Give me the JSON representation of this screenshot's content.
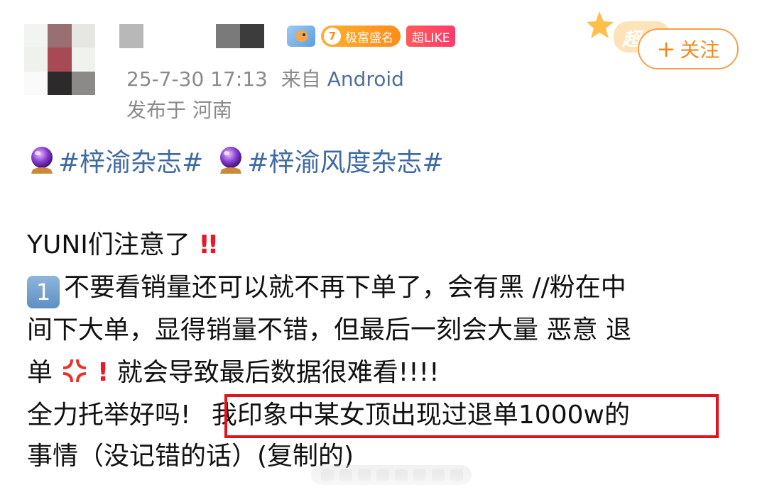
{
  "header": {
    "level": "7",
    "level_title": "极富盛名",
    "like_badge": "超LIKE",
    "timestamp": "25-7-30 17:13",
    "source_prefix": "来自",
    "source": "Android",
    "location": "发布于 河南",
    "super_deco_text": "超",
    "follow_plus": "+",
    "follow_label": "关注"
  },
  "hashtags": [
    "#梓渝杂志#",
    "#梓渝风度杂志#"
  ],
  "post": {
    "line1": "YUNI们注意了",
    "line1_mark": "!!",
    "item1_number": "1",
    "line2": "不要看销量还可以就不再下单了，会有黑 //粉在中",
    "line3": "间下大单，显得销量不错，但最后一刻会大量 恶意 退",
    "line4_start": "单",
    "line4_excl": "!",
    "line4_end": " 就会导致最后数据很难看!!!!",
    "line5_start": "全力托举好吗!",
    "line5_highlight": "我印象中某女顶出现过退单1000w的",
    "line6": "事情（没记错的话）(复制的)"
  },
  "colors": {
    "link_blue": "#3e6aa3",
    "follow_orange": "#f08a1e",
    "highlight_red": "#e0141f",
    "meta_gray": "#8a8a8a"
  },
  "icons": [
    "crystal-ball-icon",
    "keycap-one-icon",
    "anger-symbol-icon",
    "exclamation-icon",
    "double-exclamation-icon",
    "plus-icon"
  ]
}
